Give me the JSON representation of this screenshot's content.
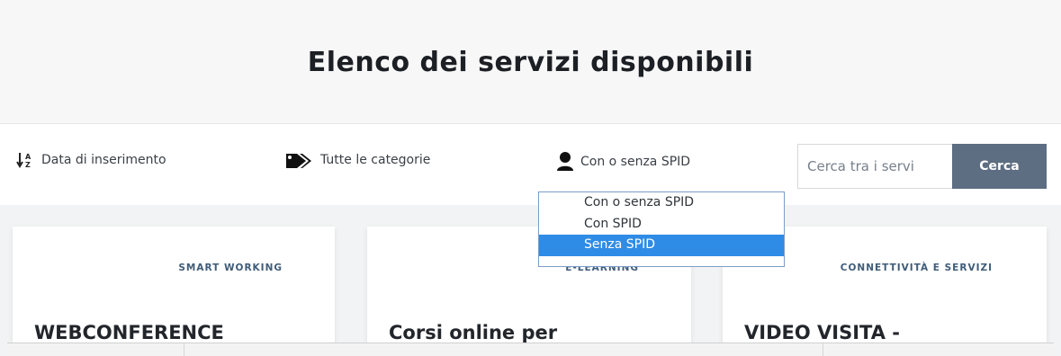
{
  "header": {
    "title": "Elenco dei servizi disponibili"
  },
  "filters": {
    "sort": {
      "icon": "sort-az-icon",
      "label": "Data di inserimento"
    },
    "category": {
      "icon": "tags-icon",
      "label": "Tutte le categorie"
    },
    "spid": {
      "icon": "user-icon",
      "label": "Con o senza SPID"
    }
  },
  "search": {
    "placeholder": "Cerca tra i servi",
    "button_label": "Cerca"
  },
  "dropdown": {
    "options": [
      "Con o senza SPID",
      "Con SPID",
      "Senza SPID"
    ],
    "selected_index": 2
  },
  "cards": [
    {
      "category": "SMART WORKING",
      "title": "WEBCONFERENCE"
    },
    {
      "category": "E-LEARNING",
      "title": "Corsi online per"
    },
    {
      "category": "CONNETTIVITÀ E SERVIZI",
      "title": "VIDEO VISITA -"
    }
  ],
  "colors": {
    "search_button": "#5d6d82",
    "dropdown_highlight": "#2f8ce6",
    "category_text": "#3f5c7a"
  }
}
